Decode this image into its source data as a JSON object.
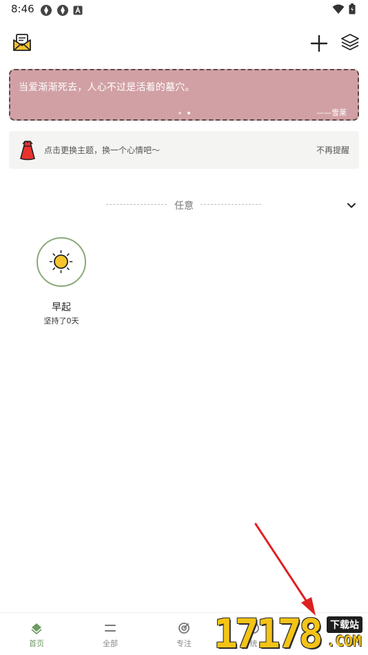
{
  "status_bar": {
    "time": "8:46"
  },
  "quote": {
    "text": "当爱渐渐死去，人心不过是活着的墓穴。",
    "author": "——雪莱"
  },
  "theme_tip": {
    "text": "点击更换主题，换一个心情吧～",
    "dismiss_label": "不再提醒"
  },
  "section": {
    "title": "任意"
  },
  "habits": [
    {
      "name": "早起",
      "streak": "坚持了0天",
      "icon": "sun-icon"
    }
  ],
  "bottom_nav": {
    "items": [
      {
        "label": "首页",
        "icon": "home-icon",
        "active": true
      },
      {
        "label": "全部",
        "icon": "list-icon",
        "active": false
      },
      {
        "label": "专注",
        "icon": "focus-icon",
        "active": false
      },
      {
        "label": "统",
        "icon": "stats-icon",
        "active": false
      }
    ]
  },
  "watermark": {
    "number": "17178",
    "badge": "下载站",
    "domain": ".COM"
  },
  "colors": {
    "quote_bg": "#d1a0a4",
    "accent_green": "#6f9a63",
    "habit_ring": "#8aaa7b",
    "arrow": "#e02020",
    "watermark_yellow": "#f4c316"
  }
}
